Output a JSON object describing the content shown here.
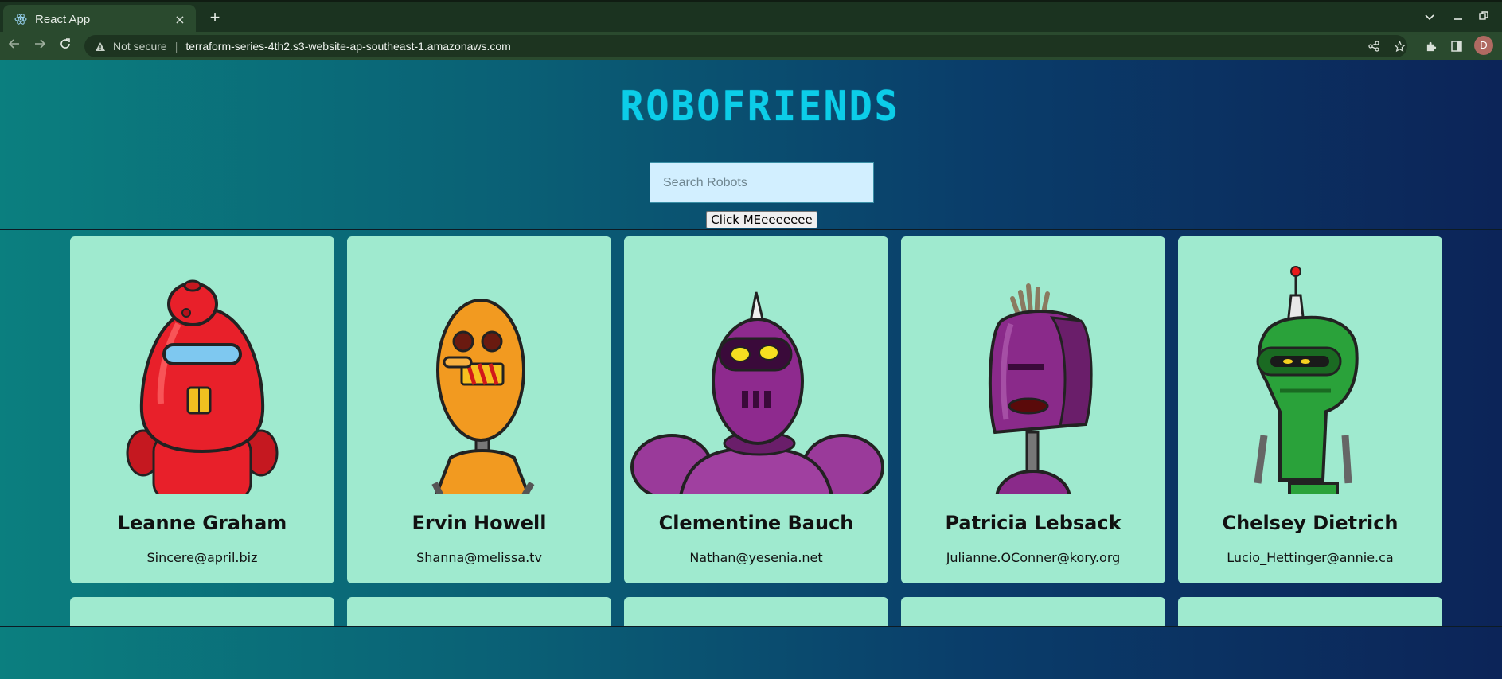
{
  "browser": {
    "tab_title": "React App",
    "close_glyph": "×",
    "newtab_glyph": "+",
    "security_label": "Not secure",
    "url": "terraform-series-4th2.s3-website-ap-southeast-1.amazonaws.com",
    "profile_initial": "D",
    "theme_color": "#2a4a2e"
  },
  "header": {
    "title": "ROBOFRIENDS",
    "title_color": "#0ccde8"
  },
  "search": {
    "placeholder": "Search Robots",
    "value": ""
  },
  "action_button": {
    "label": "Click MEeeeeeee"
  },
  "robots": [
    {
      "name": "Leanne Graham",
      "email": "Sincere@april.biz",
      "color": "#e8202a"
    },
    {
      "name": "Ervin Howell",
      "email": "Shanna@melissa.tv",
      "color": "#f29a20"
    },
    {
      "name": "Clementine Bauch",
      "email": "Nathan@yesenia.net",
      "color": "#8e2a8e"
    },
    {
      "name": "Patricia Lebsack",
      "email": "Julianne.OConner@kory.org",
      "color": "#8a2a8a"
    },
    {
      "name": "Chelsey Dietrich",
      "email": "Lucio_Hettinger@annie.ca",
      "color": "#2aa23a"
    }
  ],
  "card_color": "#9feacf"
}
